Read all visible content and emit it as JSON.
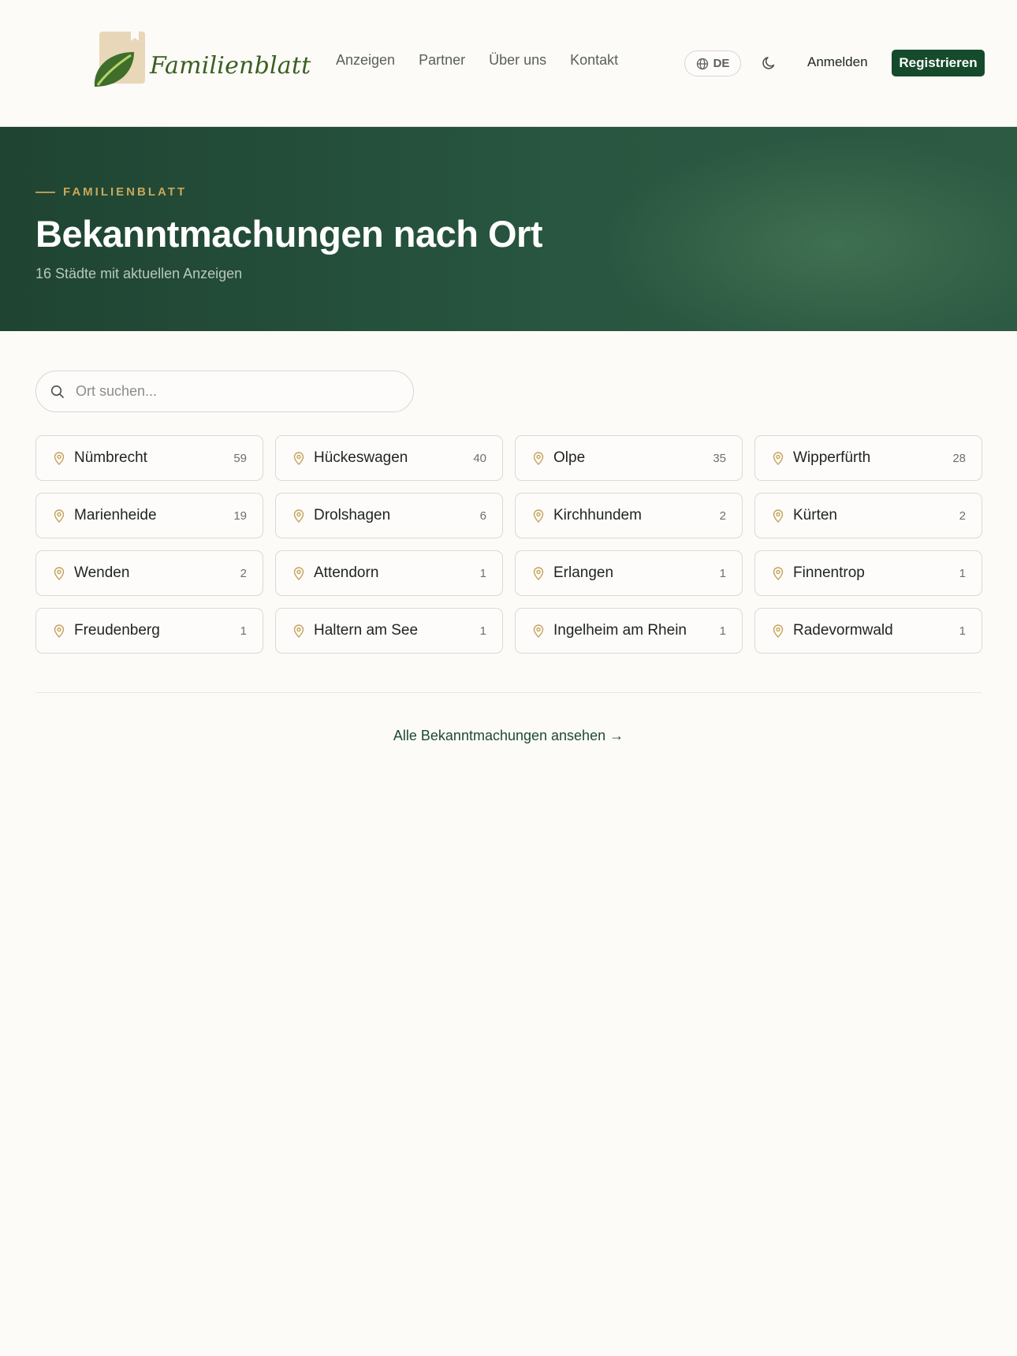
{
  "header": {
    "logo_text": "Familienblatt",
    "nav": [
      "Anzeigen",
      "Partner",
      "Über uns",
      "Kontakt"
    ],
    "language": "DE",
    "login_label": "Anmelden",
    "register_label": "Registrieren"
  },
  "hero": {
    "eyebrow": "FAMILIENBLATT",
    "title": "Bekanntmachungen nach Ort",
    "subtitle": "16 Städte mit aktuellen Anzeigen"
  },
  "search": {
    "placeholder": "Ort suchen..."
  },
  "cities": [
    {
      "name": "Nümbrecht",
      "count": "59"
    },
    {
      "name": "Hückeswagen",
      "count": "40"
    },
    {
      "name": "Olpe",
      "count": "35"
    },
    {
      "name": "Wipperfürth",
      "count": "28"
    },
    {
      "name": "Marienheide",
      "count": "19"
    },
    {
      "name": "Drolshagen",
      "count": "6"
    },
    {
      "name": "Kirchhundem",
      "count": "2"
    },
    {
      "name": "Kürten",
      "count": "2"
    },
    {
      "name": "Wenden",
      "count": "2"
    },
    {
      "name": "Attendorn",
      "count": "1"
    },
    {
      "name": "Erlangen",
      "count": "1"
    },
    {
      "name": "Finnentrop",
      "count": "1"
    },
    {
      "name": "Freudenberg",
      "count": "1"
    },
    {
      "name": "Haltern am See",
      "count": "1"
    },
    {
      "name": "Ingelheim am Rhein",
      "count": "1"
    },
    {
      "name": "Radevormwald",
      "count": "1"
    }
  ],
  "footer_link": "Alle Bekanntmachungen ansehen →",
  "colors": {
    "brand_green": "#164a2c",
    "hero_bg": "#285640",
    "accent_gold": "#c9a85a",
    "page_bg": "#fcfbf8"
  },
  "icons": [
    "globe-icon",
    "moon-icon",
    "search-icon",
    "map-pin-icon"
  ]
}
